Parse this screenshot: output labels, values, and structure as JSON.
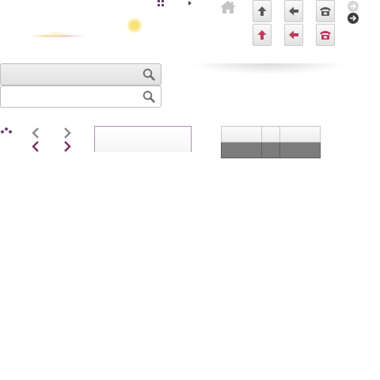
{
  "search_fields": [
    {
      "placeholder": "",
      "value": "",
      "icon": "search-icon"
    },
    {
      "placeholder": "",
      "value": "",
      "icon": "search-icon"
    }
  ],
  "buttons": {
    "up": "arrow-up-icon",
    "left": "arrow-left-icon",
    "phone": "telephone-icon"
  },
  "colors": {
    "accent": "#7a2f6c",
    "icon_gray": "#555555",
    "icon_red": "#c0395a",
    "table_header": "#eeeeee",
    "table_body": "#7c7c7c"
  },
  "table": {
    "header": [
      "",
      "",
      ""
    ],
    "rows": [
      [
        "",
        "",
        ""
      ]
    ]
  }
}
